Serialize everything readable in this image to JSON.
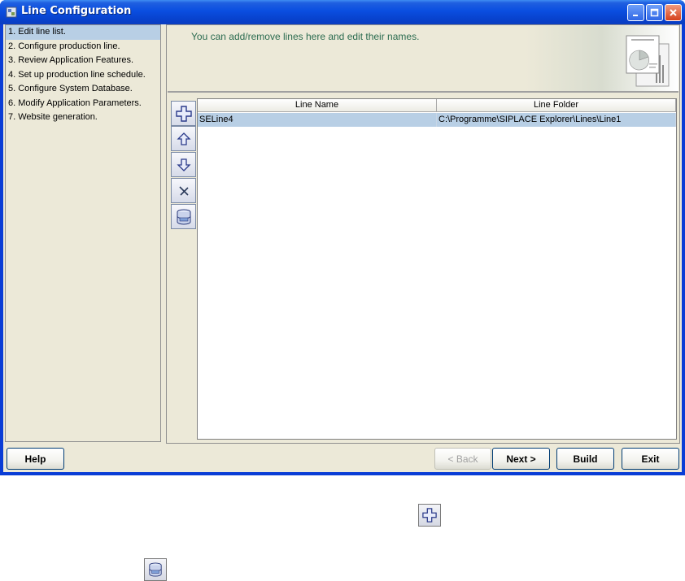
{
  "window": {
    "title": "Line Configuration",
    "controls": [
      "minimize",
      "maximize",
      "close"
    ]
  },
  "steps": [
    {
      "label": "1. Edit line list.",
      "active": true
    },
    {
      "label": "2. Configure production line."
    },
    {
      "label": "3. Review Application Features."
    },
    {
      "label": "4. Set up production line schedule."
    },
    {
      "label": "5. Configure System Database."
    },
    {
      "label": "6. Modify Application Parameters."
    },
    {
      "label": "7. Website generation."
    }
  ],
  "banner": {
    "text": "You can add/remove lines here and edit their names."
  },
  "toolbar": {
    "icons": [
      "add-icon",
      "move-up-icon",
      "move-down-icon",
      "delete-icon",
      "database-icon"
    ]
  },
  "table": {
    "columns": [
      "Line Name",
      "Line Folder"
    ],
    "rows": [
      [
        "SELine4",
        "C:\\Programme\\SIPLACE Explorer\\Lines\\Line1"
      ]
    ]
  },
  "buttons": {
    "help": "Help",
    "back": "< Back",
    "next": "Next >",
    "build": "Build",
    "exit": "Exit"
  },
  "callouts": {
    "icons": [
      "add-icon",
      "database-icon"
    ]
  },
  "colors": {
    "titlebar": "#0a4ee0",
    "selection": "#b8cfe5",
    "banner_text": "#2a6b4f",
    "face": "#ece9d8"
  }
}
